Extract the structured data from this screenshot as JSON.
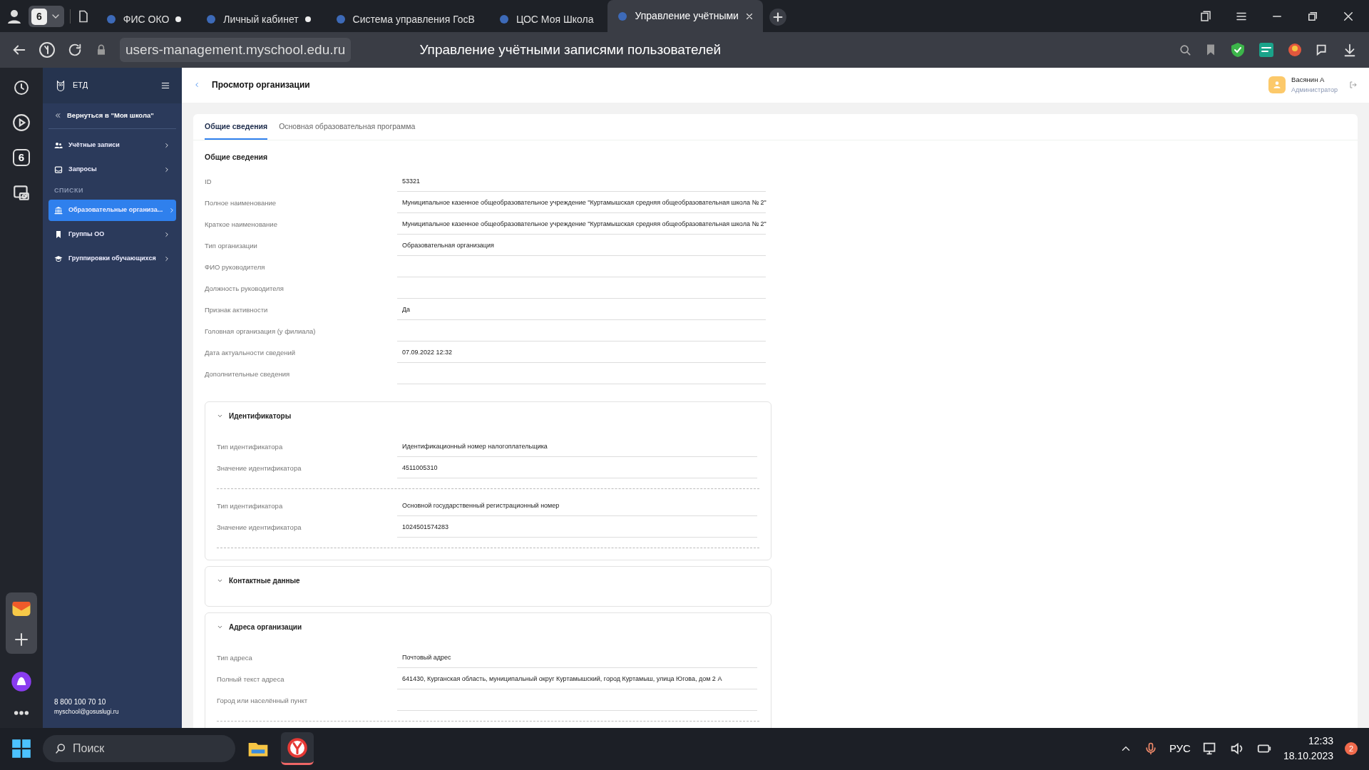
{
  "browser": {
    "tab_count": "6",
    "tabs": [
      {
        "title": "ФИС ОКО",
        "selected": false,
        "dot": true
      },
      {
        "title": "Личный кабинет",
        "selected": false,
        "dot": true
      },
      {
        "title": "Система управления ГосВ",
        "selected": false,
        "dot": false
      },
      {
        "title": "ЦОС Моя Школа",
        "selected": false,
        "dot": false
      },
      {
        "title": "Управление учётными",
        "selected": true,
        "dot": false
      }
    ],
    "address": "users-management.myschool.edu.ru",
    "page_title": "Управление учётными записями пользователей",
    "side_badge": "6"
  },
  "app": {
    "logo": "ЕТД",
    "back_link": "Вернуться в \"Моя школа\"",
    "nav": [
      {
        "label": "Учётные записи",
        "selected": false
      },
      {
        "label": "Запросы",
        "selected": false
      }
    ],
    "lists_heading": "СПИСКИ",
    "lists": [
      {
        "label": "Образовательные организа...",
        "selected": true
      },
      {
        "label": "Группы ОО",
        "selected": false
      },
      {
        "label": "Группировки обучающихся",
        "selected": false
      }
    ],
    "phone": "8 800 100 70 10",
    "email": "myschool@gosuslugi.ru"
  },
  "header": {
    "title": "Просмотр организации",
    "user": {
      "name": "Васянин А",
      "role": "Администратор"
    }
  },
  "tabs": [
    {
      "label": "Общие сведения",
      "selected": true
    },
    {
      "label": "Основная образовательная программа",
      "selected": false
    }
  ],
  "section_title": "Общие сведения",
  "fields": [
    {
      "label": "ID",
      "value": "53321"
    },
    {
      "label": "Полное наименование",
      "value": "Муниципальное казенное общеобразовательное учреждение \"Куртамышская средняя общеобразовательная школа № 2\""
    },
    {
      "label": "Краткое наименование",
      "value": "Муниципальное казенное общеобразовательное учреждение \"Куртамышская средняя общеобразовательная школа № 2\""
    },
    {
      "label": "Тип организации",
      "value": "Образовательная организация"
    },
    {
      "label": "ФИО руководителя"
    },
    {
      "label": "Должность руководителя"
    },
    {
      "label": "Признак активности",
      "value": "Да"
    },
    {
      "label": "Головная организация (у филиала)"
    },
    {
      "label": "Дата актуальности сведений",
      "value": "07.09.2022 12:32"
    },
    {
      "label": "Дополнительные сведения"
    }
  ],
  "groups": [
    {
      "title": "Идентификаторы",
      "expanded": true,
      "records": [
        [
          {
            "label": "Тип идентификатора",
            "value": "Идентификационный номер налогоплательщика"
          },
          {
            "label": "Значение идентификатора",
            "value": "4511005310"
          }
        ],
        [
          {
            "label": "Тип идентификатора",
            "value": "Основной государственный регистрационный номер"
          },
          {
            "label": "Значение идентификатора",
            "value": "1024501574283"
          }
        ]
      ]
    },
    {
      "title": "Контактные данные",
      "expanded": true
    },
    {
      "title": "Адреса организации",
      "expanded": true,
      "records": [
        [
          {
            "label": "Тип адреса",
            "value": "Почтовый адрес"
          },
          {
            "label": "Полный текст адреса",
            "value": "641430,  Курганская область, муниципальный округ Куртамышский, город Куртамыш, улица Югова, дом 2 А"
          },
          {
            "label": "Город или населённый пункт"
          }
        ]
      ]
    }
  ],
  "taskbar": {
    "search_placeholder": "Поиск",
    "language": "РУС",
    "time": "12:33",
    "date": "18.10.2023",
    "notifications": "2"
  }
}
